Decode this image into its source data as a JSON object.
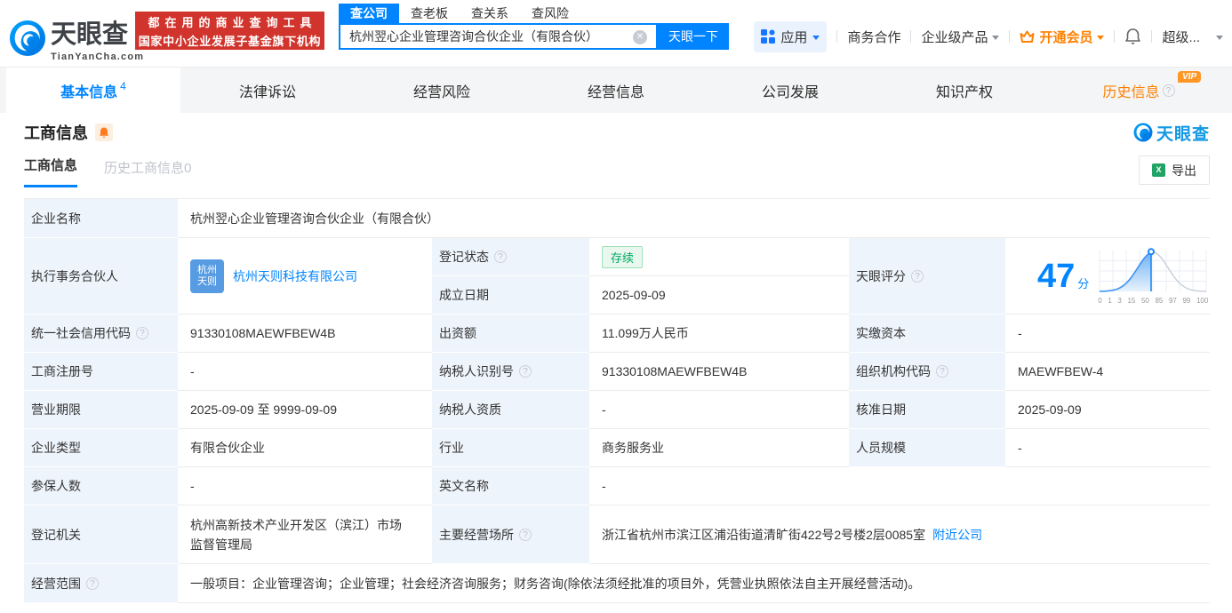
{
  "header": {
    "logo": {
      "title": "天眼查",
      "subtitle": "TianYanCha.com"
    },
    "banner": {
      "line1": "都在用的商业查询工具",
      "line2": "国家中小企业发展子基金旗下机构"
    },
    "search": {
      "tabs": [
        "查公司",
        "查老板",
        "查关系",
        "查风险"
      ],
      "active_tab": "查公司",
      "value": "杭州翌心企业管理咨询合伙企业（有限合伙）",
      "button": "天眼一下"
    },
    "nav": {
      "apps": "应用",
      "cooperation": "商务合作",
      "enterprise": "企业级产品",
      "vip": "开通会员",
      "more": "超级..."
    }
  },
  "nav_tabs": [
    {
      "label": "基本信息",
      "count": "4",
      "active": true
    },
    {
      "label": "法律诉讼"
    },
    {
      "label": "经营风险"
    },
    {
      "label": "经营信息"
    },
    {
      "label": "公司发展"
    },
    {
      "label": "知识产权"
    },
    {
      "label": "历史信息",
      "highlight": true,
      "vip": "VIP",
      "help": true
    }
  ],
  "section": {
    "title": "工商信息",
    "watermark": "天眼查"
  },
  "subtabs": {
    "active": "工商信息",
    "inactive": "历史工商信息0",
    "export": "导出"
  },
  "table": {
    "company_name": {
      "label": "企业名称",
      "value": "杭州翌心企业管理咨询合伙企业（有限合伙）"
    },
    "partner": {
      "label": "执行事务合伙人",
      "logo_line1": "杭州",
      "logo_line2": "天则",
      "link": "杭州天则科技有限公司"
    },
    "reg_status": {
      "label": "登记状态",
      "value": "存续"
    },
    "est_date": {
      "label": "成立日期",
      "value": "2025-09-09"
    },
    "score": {
      "label": "天眼评分",
      "value": "47",
      "unit": "分"
    },
    "credit_code": {
      "label": "统一社会信用代码",
      "value": "91330108MAEWFBEW4B"
    },
    "capital": {
      "label": "出资额",
      "value": "11.099万人民币"
    },
    "paid_capital": {
      "label": "实缴资本",
      "value": "-"
    },
    "reg_number": {
      "label": "工商注册号",
      "value": "-"
    },
    "taxpayer_id": {
      "label": "纳税人识别号",
      "value": "91330108MAEWFBEW4B"
    },
    "org_code": {
      "label": "组织机构代码",
      "value": "MAEWFBEW-4"
    },
    "business_term": {
      "label": "营业期限",
      "value": "2025-09-09 至 9999-09-09"
    },
    "taxpayer_quality": {
      "label": "纳税人资质",
      "value": "-"
    },
    "approval_date": {
      "label": "核准日期",
      "value": "2025-09-09"
    },
    "company_type": {
      "label": "企业类型",
      "value": "有限合伙企业"
    },
    "industry": {
      "label": "行业",
      "value": "商务服务业"
    },
    "staff_size": {
      "label": "人员规模",
      "value": "-"
    },
    "insured_count": {
      "label": "参保人数",
      "value": "-"
    },
    "english_name": {
      "label": "英文名称",
      "value": "-"
    },
    "reg_authority": {
      "label": "登记机关",
      "value": "杭州高新技术产业开发区（滨江）市场监督管理局"
    },
    "business_address": {
      "label": "主要经营场所",
      "value": "浙江省杭州市滨江区浦沿街道清旷街422号2号楼2层0085室",
      "link": "附近公司"
    },
    "business_scope": {
      "label": "经营范围",
      "value": "一般项目：企业管理咨询；企业管理；社会经济咨询服务；财务咨询(除依法须经批准的项目外，凭营业执照依法自主开展经营活动)。"
    }
  },
  "score_chart": {
    "type": "area",
    "axis": [
      "0",
      "1",
      "3",
      "15",
      "50",
      "85",
      "97",
      "99",
      "100"
    ],
    "marker_value": 47
  }
}
